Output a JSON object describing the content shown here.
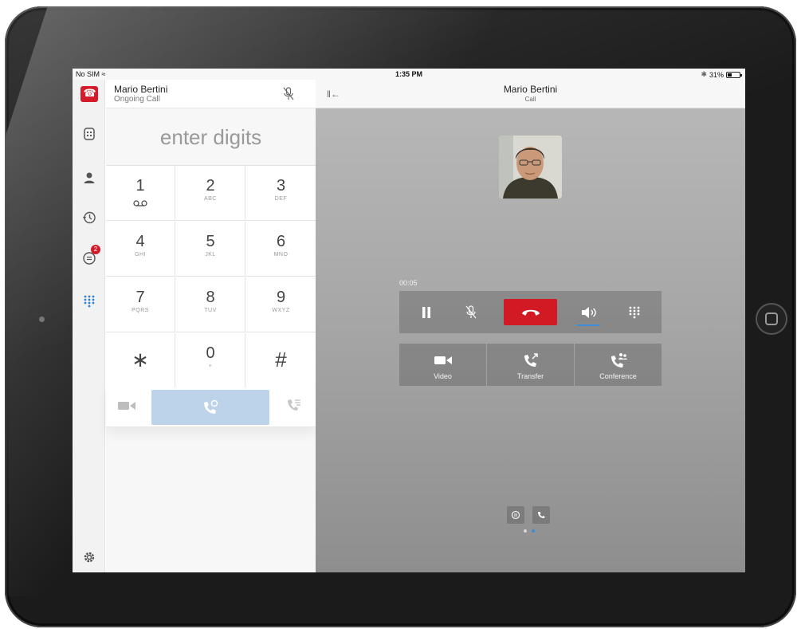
{
  "status_bar": {
    "carrier": "No SIM",
    "time": "1:35 PM",
    "battery": "31%",
    "battery_level": 0.31
  },
  "call_header": {
    "name": "Mario Bertini",
    "status": "Ongoing Call"
  },
  "dialer": {
    "placeholder": "enter digits",
    "keys": [
      {
        "digit": "1",
        "letters": ""
      },
      {
        "digit": "2",
        "letters": "ABC"
      },
      {
        "digit": "3",
        "letters": "DEF"
      },
      {
        "digit": "4",
        "letters": "GHI"
      },
      {
        "digit": "5",
        "letters": "JKL"
      },
      {
        "digit": "6",
        "letters": "MNO"
      },
      {
        "digit": "7",
        "letters": "PQRS"
      },
      {
        "digit": "8",
        "letters": "TUV"
      },
      {
        "digit": "9",
        "letters": "WXYZ"
      },
      {
        "digit": "∗",
        "letters": ""
      },
      {
        "digit": "0",
        "letters": "+"
      },
      {
        "digit": "#",
        "letters": ""
      }
    ]
  },
  "nav": {
    "chat_badge": "2"
  },
  "call_pane": {
    "title": "Mario Bertini",
    "subtitle": "Call",
    "timer": "00:05",
    "features": {
      "video": "Video",
      "transfer": "Transfer",
      "conference": "Conference"
    }
  },
  "colors": {
    "accent_red": "#d11a23",
    "call_blue": "#bcd3ea",
    "active_blue": "#3b8ed8"
  },
  "icons": [
    "voicemail-icon",
    "mute-icon",
    "hangup-icon",
    "pause-icon",
    "speaker-icon",
    "keypad-icon",
    "video-icon",
    "transfer-icon",
    "conference-icon",
    "settings-icon",
    "contacts-icon",
    "history-icon",
    "chat-icon",
    "building-icon"
  ]
}
